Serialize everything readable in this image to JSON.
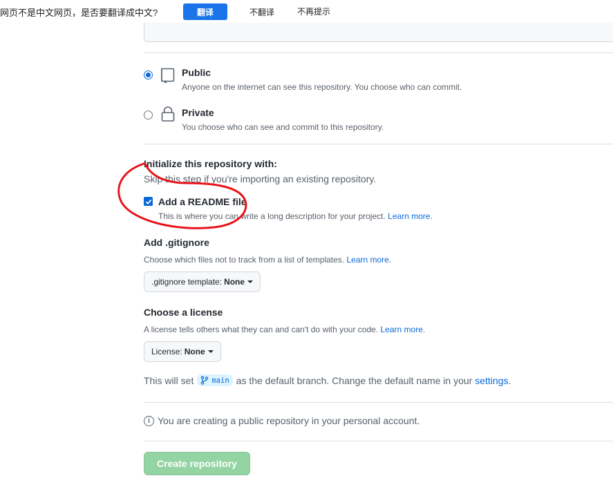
{
  "translate_bar": {
    "prompt": "网页不是中文网页，是否要翻译成中文?",
    "translate_label": "翻译",
    "dont_translate_label": "不翻译",
    "never_show_label": "不再提示"
  },
  "visibility": {
    "public": {
      "title": "Public",
      "description": "Anyone on the internet can see this repository. You choose who can commit.",
      "selected": true
    },
    "private": {
      "title": "Private",
      "description": "You choose who can see and commit to this repository.",
      "selected": false
    }
  },
  "initialize": {
    "title": "Initialize this repository with:",
    "subtitle": "Skip this step if you're importing an existing repository."
  },
  "readme": {
    "label": "Add a README file",
    "checked": true,
    "description": "This is where you can write a long description for your project.",
    "learn_more": "Learn more."
  },
  "gitignore": {
    "title": "Add .gitignore",
    "description": "Choose which files not to track from a list of templates.",
    "learn_more": "Learn more.",
    "select_prefix": ".gitignore template:",
    "select_value": "None"
  },
  "license": {
    "title": "Choose a license",
    "description": "A license tells others what they can and can't do with your code.",
    "learn_more": "Learn more.",
    "select_prefix": "License:",
    "select_value": "None"
  },
  "branch": {
    "prefix": "This will set",
    "name": "main",
    "suffix": "as the default branch. Change the default name in your",
    "settings_link": "settings",
    "end": "."
  },
  "info": {
    "text": "You are creating a public repository in your personal account."
  },
  "create_button": {
    "label": "Create repository"
  },
  "colors": {
    "accent": "#0969da",
    "translate_blue": "#1a73e8",
    "create_disabled": "#94d3a2",
    "annotation_red": "#e8141a"
  }
}
